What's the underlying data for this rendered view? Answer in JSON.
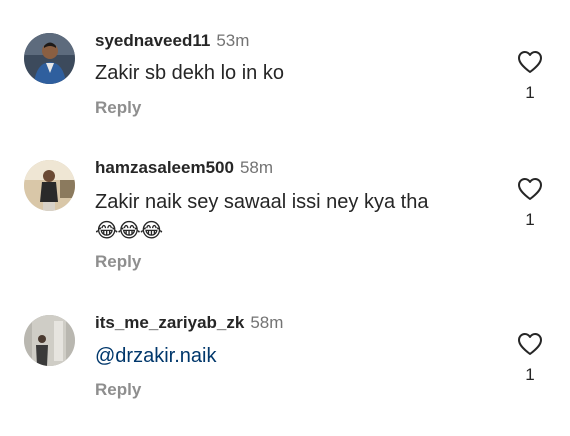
{
  "comments": [
    {
      "username": "syednaveed11",
      "time": "53m",
      "text": "Zakir sb dekh lo in ko",
      "emoji": "",
      "reply_label": "Reply",
      "like_count": "1"
    },
    {
      "username": "hamzasaleem500",
      "time": "58m",
      "text": "Zakir naik sey sawaal issi ney kya tha",
      "emoji": "😂😂😂",
      "reply_label": "Reply",
      "like_count": "1"
    },
    {
      "username": "its_me_zariyab_zk",
      "time": "58m",
      "text": "@drzakir.naik",
      "emoji": "",
      "reply_label": "Reply",
      "like_count": "1"
    }
  ],
  "colors": {
    "text": "#262626",
    "muted": "#737373",
    "reply": "#8e8e8e",
    "mention": "#00376b"
  }
}
